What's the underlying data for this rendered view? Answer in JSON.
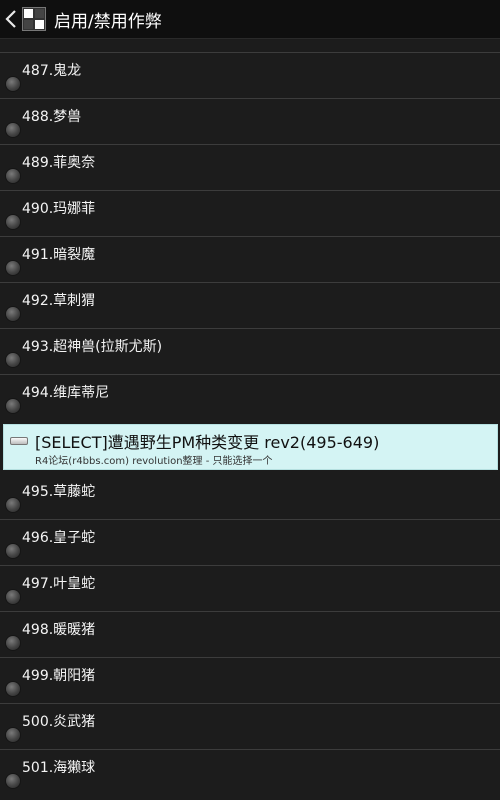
{
  "header": {
    "title": "启用/禁用作弊"
  },
  "items_before": [
    "487.鬼龙",
    "488.梦兽",
    "489.菲奥奈",
    "490.玛娜菲",
    "491.暗裂魔",
    "492.草刺猬",
    "493.超神兽(拉斯尤斯)",
    "494.维库蒂尼"
  ],
  "section": {
    "title": "[SELECT]遭遇野生PM种类变更 rev2(495-649)",
    "subtitle": "R4论坛(r4bbs.com) revolution整理 - 只能选择一个"
  },
  "items_after": [
    "495.草藤蛇",
    "496.皇子蛇",
    "497.叶皇蛇",
    "498.暖暖猪",
    "499.朝阳猪",
    "500.炎武猪",
    "501.海獭球"
  ]
}
